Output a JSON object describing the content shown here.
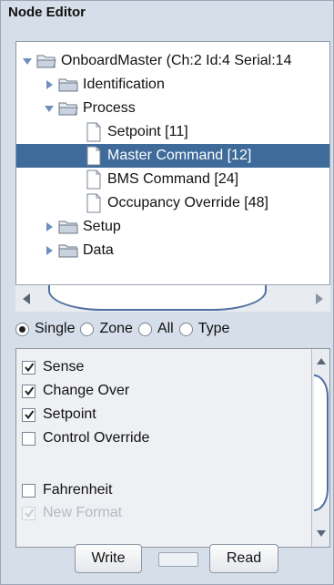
{
  "panel": {
    "title": "Node Editor"
  },
  "tree": {
    "items": [
      {
        "label": "OnboardMaster (Ch:2 Id:4 Serial:14",
        "type": "folder",
        "expanded": true
      },
      {
        "label": "Identification",
        "type": "folder",
        "expanded": false
      },
      {
        "label": "Process",
        "type": "folder",
        "expanded": true
      },
      {
        "label": "Setpoint [11]",
        "type": "file"
      },
      {
        "label": "Master Command [12]",
        "type": "file",
        "selected": true
      },
      {
        "label": "BMS Command [24]",
        "type": "file"
      },
      {
        "label": "Occupancy Override [48]",
        "type": "file"
      },
      {
        "label": "Setup",
        "type": "folder",
        "expanded": false
      },
      {
        "label": "Data",
        "type": "folder",
        "expanded": false
      }
    ]
  },
  "mode": {
    "options": [
      "Single",
      "Zone",
      "All",
      "Type"
    ],
    "selected": "Single"
  },
  "checks": {
    "items": [
      {
        "label": "Sense",
        "checked": true
      },
      {
        "label": "Change Over",
        "checked": true
      },
      {
        "label": "Setpoint",
        "checked": true
      },
      {
        "label": "Control Override",
        "checked": false
      },
      {
        "label": "Fahrenheit",
        "checked": false
      },
      {
        "label": "New Format",
        "checked": true,
        "disabled": true
      }
    ]
  },
  "actions": {
    "write_label": "Write",
    "read_label": "Read"
  },
  "colors": {
    "selection": "#3e6b9a",
    "panel_bg": "#d6deea",
    "scroll_accent": "#4d6fa0"
  }
}
